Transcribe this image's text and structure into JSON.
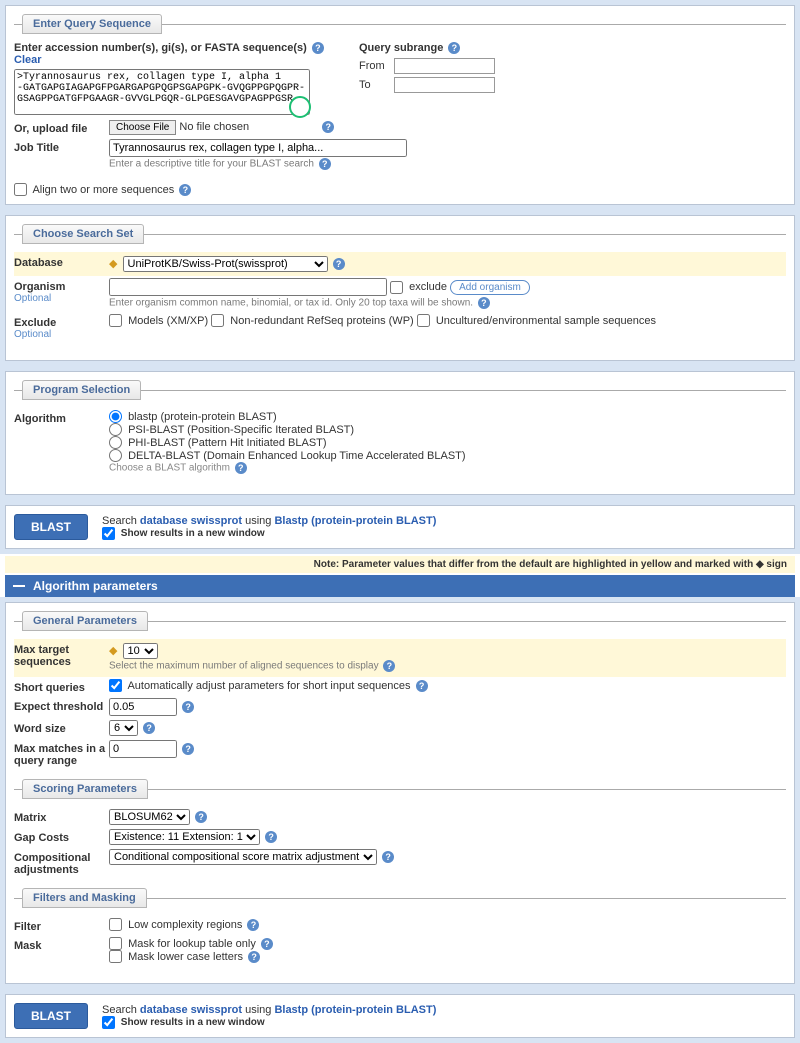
{
  "eq": {
    "legend": "Enter Query Sequence",
    "prompt": "Enter accession number(s), gi(s), or FASTA sequence(s)",
    "clear": "Clear",
    "seq": ">Tyrannosaurus rex, collagen type I, alpha 1\n-GATGAPGIAGAPGFPGARGAPGPQGPSGAPGPK-GVQGPPGPQGPR-\nGSAGPPGATGFPGAAGR-GVVGLPGQR-GLPGESGAVGPAGPPGSR-",
    "subrange": "Query subrange",
    "from": "From",
    "to": "To",
    "orLabel": "Or, upload file",
    "choose": "Choose File",
    "nofile": "No file chosen",
    "jtLabel": "Job Title",
    "jtVal": "Tyrannosaurus rex, collagen type I, alpha...",
    "jtHint": "Enter a descriptive title for your BLAST search",
    "align": "Align two or more sequences"
  },
  "css": {
    "legend": "Choose Search Set",
    "dbLabel": "Database",
    "dbVal": "UniProtKB/Swiss-Prot(swissprot)",
    "orgLabel": "Organism",
    "opt": "Optional",
    "exclude": "exclude",
    "addorg": "Add organism",
    "orgHint": "Enter organism common name, binomial, or tax id. Only 20 top taxa will be shown.",
    "exLabel": "Exclude",
    "ex1": "Models (XM/XP)",
    "ex2": "Non-redundant RefSeq proteins (WP)",
    "ex3": "Uncultured/environmental sample sequences"
  },
  "ps": {
    "legend": "Program Selection",
    "algLabel": "Algorithm",
    "o1": "blastp (protein-protein BLAST)",
    "o2": "PSI-BLAST (Position-Specific Iterated BLAST)",
    "o3": "PHI-BLAST (Pattern Hit Initiated BLAST)",
    "o4": "DELTA-BLAST (Domain Enhanced Lookup Time Accelerated BLAST)",
    "hint": "Choose a BLAST algorithm"
  },
  "run": {
    "btn": "BLAST",
    "p1": "Search ",
    "db": "database swissprot",
    "p2": " using ",
    "prog": "Blastp (protein-protein BLAST)",
    "show": "Show results in a new window"
  },
  "note": "Note: Parameter values that differ from the default are highlighted in yellow and marked with ◆ sign",
  "algoHdr": "Algorithm parameters",
  "gp": {
    "legend": "General Parameters",
    "mtsLabel": "Max target sequences",
    "mtsVal": "10",
    "mtsHint": "Select the maximum number of aligned sequences to display",
    "sqLabel": "Short queries",
    "sqText": "Automatically adjust parameters for short input sequences",
    "etLabel": "Expect threshold",
    "etVal": "0.05",
    "wsLabel": "Word size",
    "wsVal": "6",
    "mmLabel": "Max matches in a query range",
    "mmVal": "0"
  },
  "sp": {
    "legend": "Scoring Parameters",
    "mLabel": "Matrix",
    "mVal": "BLOSUM62",
    "gcLabel": "Gap Costs",
    "gcVal": "Existence: 11 Extension: 1",
    "caLabel": "Compositional adjustments",
    "caVal": "Conditional compositional score matrix adjustment"
  },
  "fm": {
    "legend": "Filters and Masking",
    "fLabel": "Filter",
    "f1": "Low complexity regions",
    "mLabel": "Mask",
    "m1": "Mask for lookup table only",
    "m2": "Mask lower case letters"
  }
}
